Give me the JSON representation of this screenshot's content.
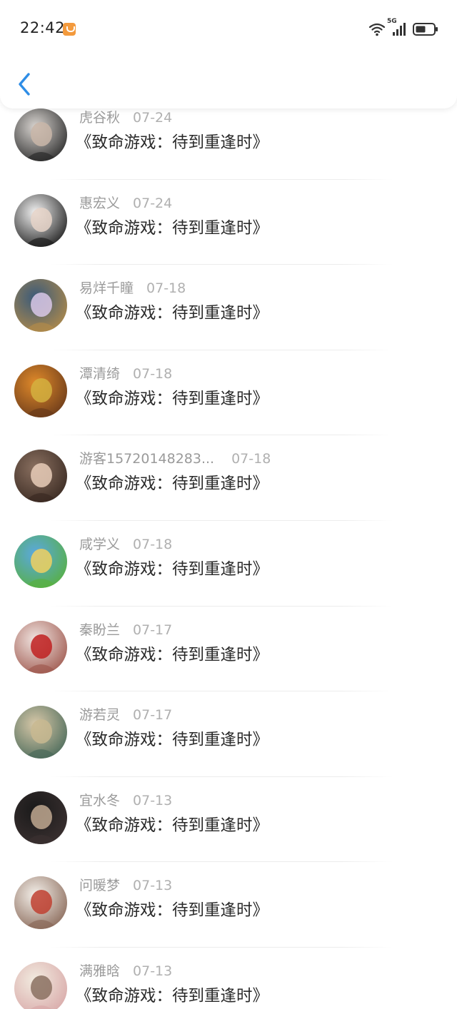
{
  "status_bar": {
    "time": "22:42",
    "network": "5G",
    "icons": [
      "app-notification-icon",
      "wifi-icon",
      "signal-icon",
      "battery-icon"
    ]
  },
  "nav": {
    "back_icon": "chevron-left-icon",
    "accent_color": "#2e8de6"
  },
  "items": [
    {
      "name": "虎谷秋",
      "date": "07-24",
      "title": "《致命游戏：待到重逢时》",
      "avatar_colors": [
        "#d8d4d0",
        "#2b2b2b",
        "#c9b6a8"
      ]
    },
    {
      "name": "惠宏义",
      "date": "07-24",
      "title": "《致命游戏：待到重逢时》",
      "avatar_colors": [
        "#f2f2f2",
        "#1e1e1e",
        "#e6d4c8"
      ]
    },
    {
      "name": "易烊千瞳",
      "date": "07-18",
      "title": "《致命游戏：待到重逢时》",
      "avatar_colors": [
        "#3a5a7a",
        "#b08a4a",
        "#d9c8e8"
      ]
    },
    {
      "name": "潭清绮",
      "date": "07-18",
      "title": "《致命游戏：待到重逢时》",
      "avatar_colors": [
        "#e08a2a",
        "#6a3a1a",
        "#d4b040"
      ]
    },
    {
      "name": "游客15720148283...",
      "date": "07-18",
      "title": "《致命游戏：待到重逢时》",
      "avatar_colors": [
        "#8a7060",
        "#3a2a22",
        "#e8cdb8"
      ]
    },
    {
      "name": "咸学义",
      "date": "07-18",
      "title": "《致命游戏：待到重逢时》",
      "avatar_colors": [
        "#5aa8e0",
        "#58b040",
        "#f0d060"
      ]
    },
    {
      "name": "秦盼兰",
      "date": "07-17",
      "title": "《致命游戏：待到重逢时》",
      "avatar_colors": [
        "#f0e4e0",
        "#a05a50",
        "#c02020"
      ]
    },
    {
      "name": "游若灵",
      "date": "07-17",
      "title": "《致命游戏：待到重逢时》",
      "avatar_colors": [
        "#d8c8a8",
        "#4a6a5a",
        "#c8b890"
      ]
    },
    {
      "name": "宜水冬",
      "date": "07-13",
      "title": "《致命游戏：待到重逢时》",
      "avatar_colors": [
        "#1a1a1a",
        "#3a3030",
        "#c0a890"
      ]
    },
    {
      "name": "问暖梦",
      "date": "07-13",
      "title": "《致命游戏：待到重逢时》",
      "avatar_colors": [
        "#f4f0ea",
        "#8a6a5a",
        "#c04030"
      ]
    },
    {
      "name": "满雅晗",
      "date": "07-13",
      "title": "《致命游戏：待到重逢时》",
      "avatar_colors": [
        "#f2ece0",
        "#d8a8a8",
        "#8a7060"
      ]
    }
  ]
}
